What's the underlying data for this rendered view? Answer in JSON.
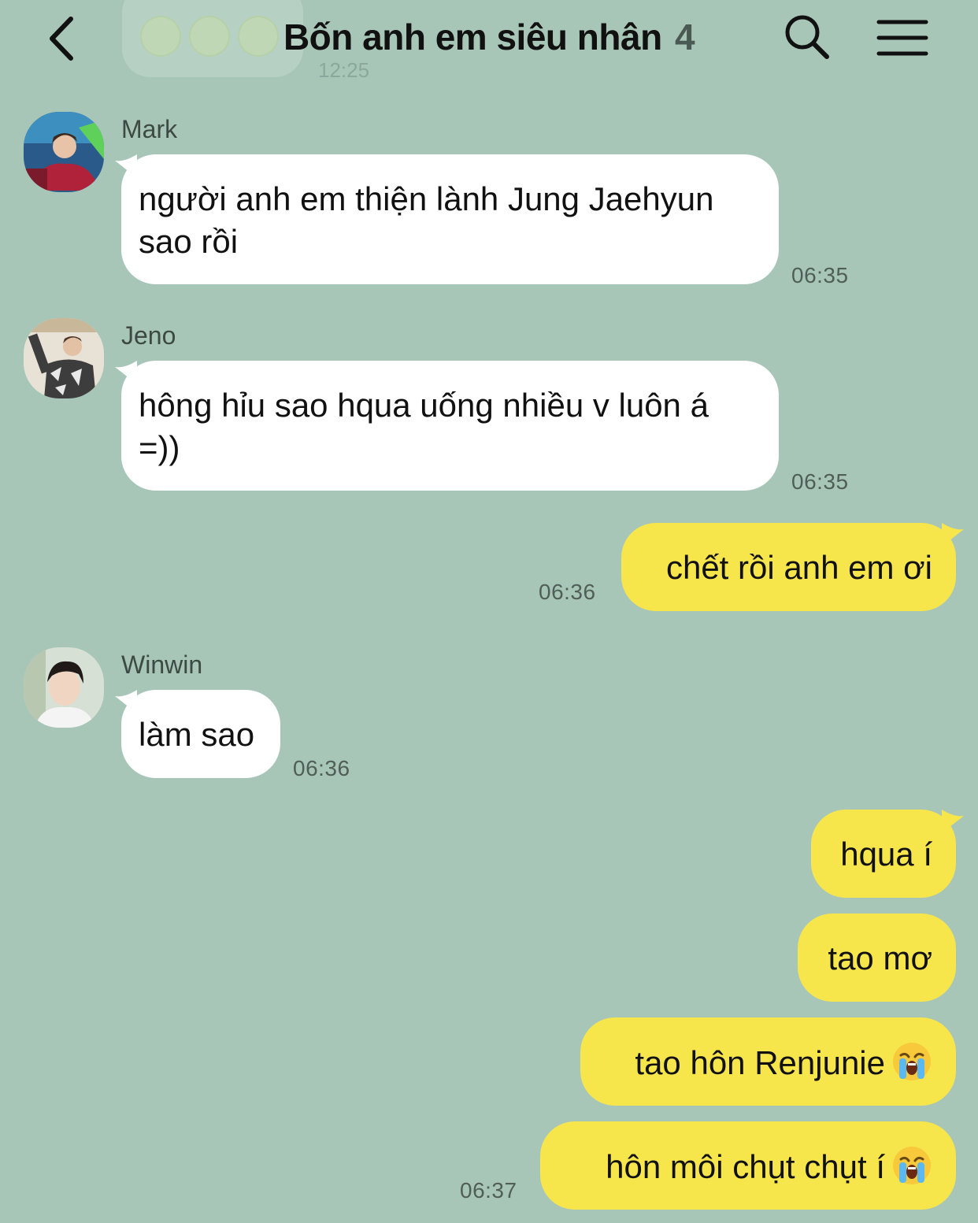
{
  "header": {
    "title": "Bốn anh em siêu nhân",
    "member_count": "4"
  },
  "ghost_message": {
    "time": "12:25"
  },
  "messages": [
    {
      "sender": "Mark",
      "text_line1": "người anh em thiện lành Jung Jaehyun",
      "text_line2": "sao rồi",
      "time": "06:35"
    },
    {
      "sender": "Jeno",
      "text_line1": "hông hỉu sao hqua uống nhiều v luôn á",
      "text_line2": "=))",
      "time": "06:35"
    },
    {
      "sender": "me",
      "text": "chết rồi anh em ơi",
      "time": "06:36"
    },
    {
      "sender": "Winwin",
      "text": "làm sao",
      "time": "06:36"
    },
    {
      "sender": "me",
      "text": "hqua í"
    },
    {
      "sender": "me",
      "text": "tao mơ"
    },
    {
      "sender": "me",
      "text": "tao hôn Renjunie",
      "emoji": "loudly-crying-face"
    },
    {
      "sender": "me",
      "text": "hôn môi chụt chụt í",
      "emoji": "loudly-crying-face",
      "time": "06:37"
    }
  ],
  "colors": {
    "background": "#a8c6b8",
    "incoming_bubble": "#ffffff",
    "outgoing_bubble": "#f7e54c"
  }
}
